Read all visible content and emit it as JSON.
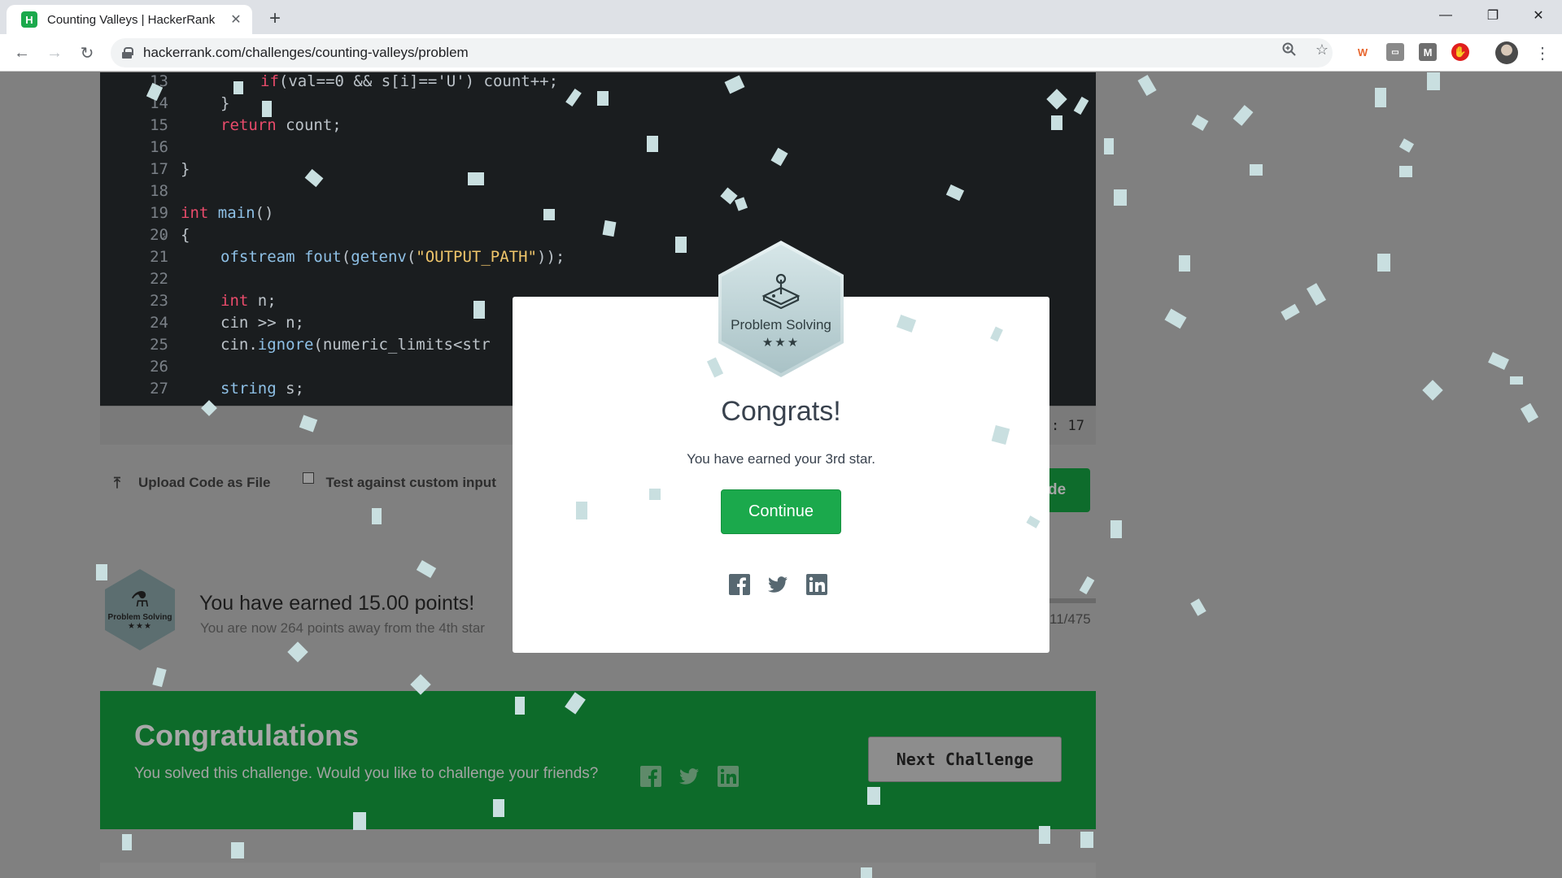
{
  "browser": {
    "tab_title": "Counting Valleys | HackerRank",
    "tab_favicon": "H",
    "url": "hackerrank.com/challenges/counting-valleys/problem",
    "extensions": [
      "W",
      "M"
    ]
  },
  "editor": {
    "lines": [
      {
        "num": "13",
        "code": "        if(val==0 && s[i]=='U') count++;"
      },
      {
        "num": "14",
        "code": "    }"
      },
      {
        "num": "15",
        "code": "    return count;"
      },
      {
        "num": "16",
        "code": ""
      },
      {
        "num": "17",
        "code": "}"
      },
      {
        "num": "18",
        "code": ""
      },
      {
        "num": "19",
        "code": "int main()"
      },
      {
        "num": "20",
        "code": "{"
      },
      {
        "num": "21",
        "code": "    ofstream fout(getenv(\"OUTPUT_PATH\"));"
      },
      {
        "num": "22",
        "code": ""
      },
      {
        "num": "23",
        "code": "    int n;"
      },
      {
        "num": "24",
        "code": "    cin >> n;"
      },
      {
        "num": "25",
        "code": "    cin.ignore(numeric_limits<str"
      },
      {
        "num": "26",
        "code": ""
      },
      {
        "num": "27",
        "code": "    string s;"
      }
    ],
    "cursor_position": ": 17"
  },
  "actions": {
    "upload_label": "Upload Code as File",
    "custom_input_label": "Test against custom input",
    "submit_fragment": "de"
  },
  "points": {
    "badge_label": "Problem Solving",
    "badge_stars": "★★★",
    "title": "You have earned 15.00 points!",
    "subtitle": "You are now 264 points away from the 4th star",
    "progress": "11/475"
  },
  "banner": {
    "title": "Congratulations",
    "subtitle": "You solved this challenge. Would you like to challenge your friends?",
    "next_button": "Next Challenge"
  },
  "modal": {
    "badge_label": "Problem Solving",
    "badge_stars": "★★★",
    "title": "Congrats!",
    "subtitle": "You have earned your 3rd star.",
    "continue_button": "Continue"
  },
  "colors": {
    "brand_green": "#1ba94c",
    "banner_green": "#0d6b2a",
    "editor_bg": "#1a1d1f"
  }
}
